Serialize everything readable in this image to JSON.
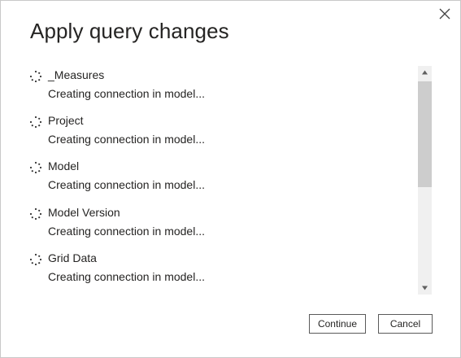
{
  "dialog": {
    "title": "Apply query changes",
    "close_icon": "close-icon"
  },
  "queries": [
    {
      "name": "_Measures",
      "status": "Creating connection in model..."
    },
    {
      "name": "Project",
      "status": "Creating connection in model..."
    },
    {
      "name": "Model",
      "status": "Creating connection in model..."
    },
    {
      "name": "Model Version",
      "status": "Creating connection in model..."
    },
    {
      "name": "Grid Data",
      "status": "Creating connection in model..."
    }
  ],
  "buttons": {
    "continue_label": "Continue",
    "cancel_label": "Cancel"
  },
  "colors": {
    "text": "#252423",
    "scroll_track": "#f0f0f0",
    "scroll_thumb": "#cdcdcd",
    "border": "#c8c8c8"
  }
}
